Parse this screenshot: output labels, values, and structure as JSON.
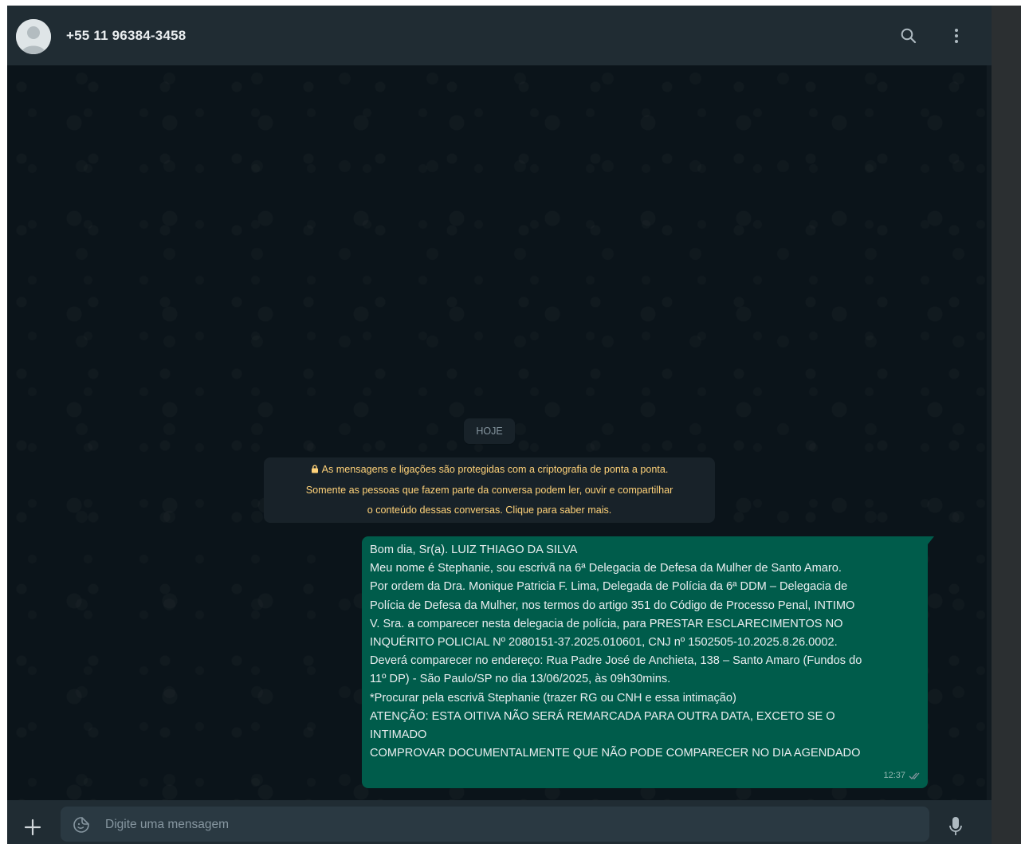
{
  "header": {
    "contact_name": "+55 11 96384-3458",
    "search_icon": "search-icon",
    "menu_icon": "kebab-menu-icon"
  },
  "chat": {
    "date_chip": "HOJE",
    "encryption_notice": {
      "lines": [
        "As mensagens e ligações são protegidas com a criptografia de ponta a ponta.",
        "Somente as pessoas que fazem parte da conversa podem ler, ouvir e compartilhar",
        "o conteúdo dessas conversas. Clique para saber mais."
      ]
    },
    "message": {
      "lines": [
        "Bom dia, Sr(a). LUIZ THIAGO DA SILVA",
        "Meu nome é Stephanie, sou escrivã na 6ª Delegacia de Defesa da Mulher de Santo Amaro.",
        "Por ordem da Dra. Monique Patricia F. Lima, Delegada de Polícia da 6ª DDM – Delegacia de",
        "Polícia de Defesa da Mulher, nos termos do artigo 351 do Código de Processo Penal, INTIMO",
        "V. Sra. a comparecer nesta delegacia de polícia, para PRESTAR ESCLARECIMENTOS NO",
        "INQUÉRITO POLICIAL Nº 2080151-37.2025.010601, CNJ nº 1502505-10.2025.8.26.0002.",
        "Deverá comparecer no endereço: Rua Padre José de Anchieta, 138 – Santo Amaro (Fundos do",
        "11º DP) - São Paulo/SP no dia 13/06/2025, às 09h30mins.",
        "*Procurar pela escrivã Stephanie (trazer RG ou CNH e essa intimação)",
        "ATENÇÃO: ESTA OITIVA NÃO SERÁ REMARCADA PARA OUTRA DATA, EXCETO SE O",
        "INTIMADO",
        "COMPROVAR DOCUMENTALMENTE QUE NÃO PODE COMPARECER NO DIA AGENDADO"
      ],
      "time": "12:37",
      "status": "read",
      "status_color": "#8696a0"
    }
  },
  "footer": {
    "placeholder": "Digite uma mensagem",
    "value": ""
  },
  "colors": {
    "app_bg": "#0b141a",
    "panel": "#202c33",
    "outgoing_bubble": "#005c4b",
    "notice_text": "#ffd279",
    "input_bg": "#2a3942"
  }
}
